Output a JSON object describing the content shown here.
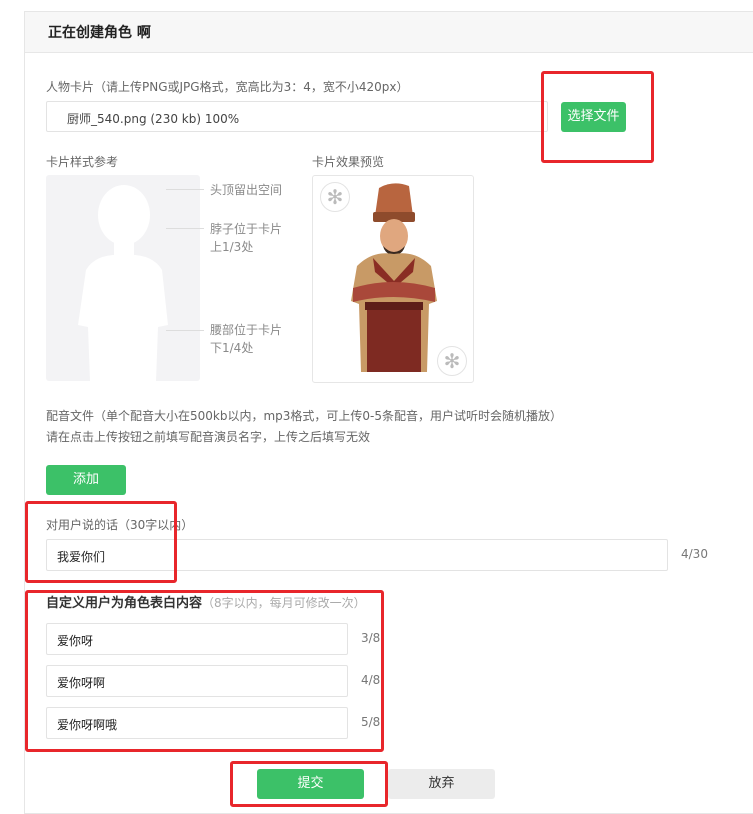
{
  "header": {
    "title": "正在创建角色 啊"
  },
  "card_upload": {
    "label": "人物卡片（请上传PNG或JPG格式，宽高比为3：4，宽不小420px）",
    "file_value": "厨师_540.png (230 kb) 100%",
    "choose_button": "选择文件"
  },
  "reference": {
    "label": "卡片样式参考",
    "hints": [
      "头顶留出空间",
      "脖子位于卡片\n上1/3处",
      "腰部位于卡片\n下1/4处"
    ]
  },
  "preview": {
    "label": "卡片效果预览"
  },
  "voice": {
    "label_line1": "配音文件（单个配音大小在500kb以内，mp3格式，可上传0-5条配音，用户试听时会随机播放）",
    "label_line2": "请在点击上传按钮之前填写配音演员名字，上传之后填写无效",
    "add_button": "添加"
  },
  "greeting": {
    "label": "对用户说的话（30字以内）",
    "value": "我爱你们",
    "counter": "4/30"
  },
  "confession": {
    "title": "自定义用户为角色表白内容",
    "subtitle": "（8字以内，每月可修改一次）",
    "items": [
      {
        "value": "爱你呀",
        "counter": "3/8"
      },
      {
        "value": "爱你呀啊",
        "counter": "4/8"
      },
      {
        "value": "爱你呀啊哦",
        "counter": "5/8"
      }
    ]
  },
  "actions": {
    "submit": "提交",
    "cancel": "放弃"
  },
  "colors": {
    "accent": "#3cc168",
    "highlight": "#e8262b"
  }
}
